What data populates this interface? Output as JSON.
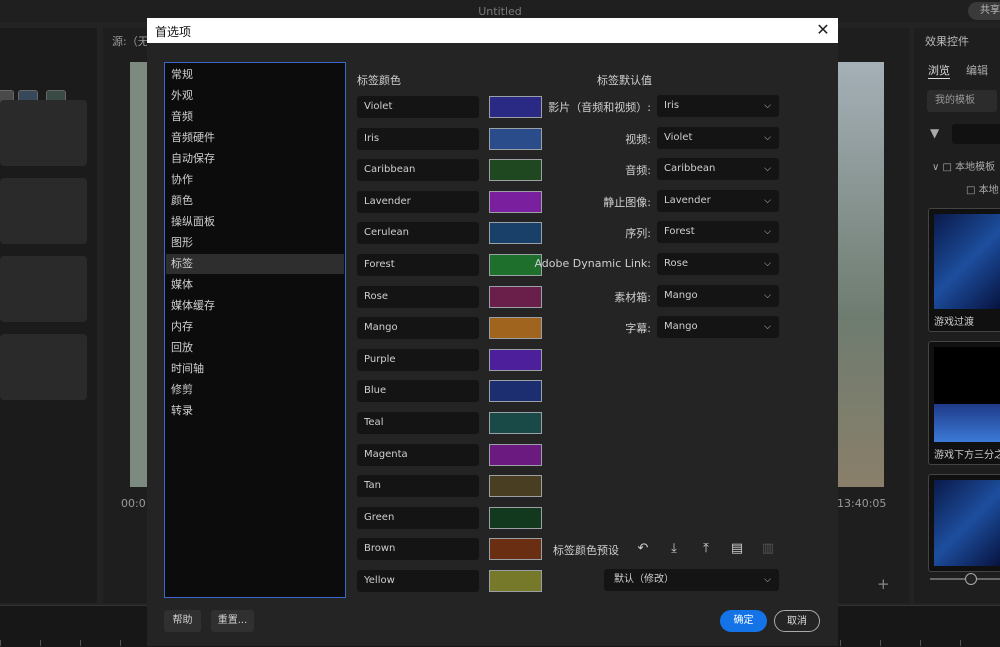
{
  "app": {
    "title": "Untitled",
    "share": "共享"
  },
  "monitor": {
    "source_label": "源:（无",
    "timecode_left": "00:0",
    "timecode_right": "13:40:05"
  },
  "effects": {
    "title": "效果控件",
    "tabs": [
      "浏览",
      "编辑"
    ],
    "my_templates": "我的模板",
    "tree": [
      "本地模板",
      "本地"
    ],
    "cards": [
      "游戏过渡",
      "游戏下方三分之"
    ]
  },
  "dialog": {
    "title": "首选项",
    "categories": [
      "常规",
      "外观",
      "音频",
      "音频硬件",
      "自动保存",
      "协作",
      "颜色",
      "操纵面板",
      "图形",
      "标签",
      "媒体",
      "媒体缓存",
      "内存",
      "回放",
      "时间轴",
      "修剪",
      "转录"
    ],
    "selected_category": "标签",
    "label_colors_header": "标签颜色",
    "label_defaults_header": "标签默认值",
    "label_colors": [
      {
        "name": "Violet",
        "color": "#2a2a85"
      },
      {
        "name": "Iris",
        "color": "#2a4c8a"
      },
      {
        "name": "Caribbean",
        "color": "#1f4720"
      },
      {
        "name": "Lavender",
        "color": "#7a1f9e"
      },
      {
        "name": "Cerulean",
        "color": "#194068"
      },
      {
        "name": "Forest",
        "color": "#1e6e2c"
      },
      {
        "name": "Rose",
        "color": "#6a1e4a"
      },
      {
        "name": "Mango",
        "color": "#a0641e"
      },
      {
        "name": "Purple",
        "color": "#4e1f9a"
      },
      {
        "name": "Blue",
        "color": "#1c2e70"
      },
      {
        "name": "Teal",
        "color": "#1a4a47"
      },
      {
        "name": "Magenta",
        "color": "#6b1a80"
      },
      {
        "name": "Tan",
        "color": "#4a3e22"
      },
      {
        "name": "Green",
        "color": "#12381e"
      },
      {
        "name": "Brown",
        "color": "#6a2e12"
      },
      {
        "name": "Yellow",
        "color": "#76782a"
      }
    ],
    "label_defaults": [
      {
        "label": "影片（音频和视频）:",
        "value": "Iris"
      },
      {
        "label": "视频:",
        "value": "Violet"
      },
      {
        "label": "音频:",
        "value": "Caribbean"
      },
      {
        "label": "静止图像:",
        "value": "Lavender"
      },
      {
        "label": "序列:",
        "value": "Forest"
      },
      {
        "label": "Adobe Dynamic Link:",
        "value": "Rose"
      },
      {
        "label": "素材箱:",
        "value": "Mango"
      },
      {
        "label": "字幕:",
        "value": "Mango"
      }
    ],
    "preset_label": "标签颜色预设",
    "preset_value": "默认（修改）",
    "icons": [
      "undo-icon",
      "import-icon",
      "export-icon",
      "folder-icon",
      "trash-icon"
    ],
    "buttons": {
      "help": "帮助",
      "reset": "重置...",
      "ok": "确定",
      "cancel": "取消"
    }
  }
}
